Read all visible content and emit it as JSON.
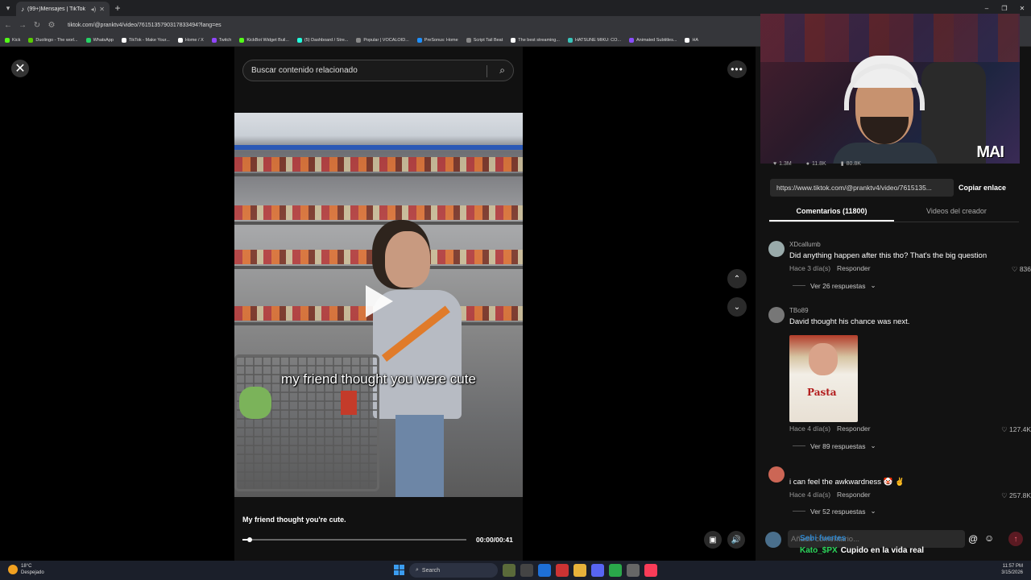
{
  "browser": {
    "tab_title": "(99+)Mensajes | TikTok",
    "url": "tiktok.com/@pranktv4/video/7615135790317833494?lang=es",
    "bookmarks": [
      {
        "label": "Kick",
        "color": "#53fc18"
      },
      {
        "label": "Duolingo - The worl...",
        "color": "#58cc02"
      },
      {
        "label": "WhatsApp",
        "color": "#25d366"
      },
      {
        "label": "TikTok - Make Your...",
        "color": "#ffffff"
      },
      {
        "label": "Home / X",
        "color": "#ffffff"
      },
      {
        "label": "Twitch",
        "color": "#9146ff"
      },
      {
        "label": "KickBot Widget Buil...",
        "color": "#53fc18"
      },
      {
        "label": "(5) Dashboard / Stre...",
        "color": "#2fd"
      },
      {
        "label": "Popular | VOCALOID...",
        "color": "#888888"
      },
      {
        "label": "PreSonus: Home",
        "color": "#1e90ff"
      },
      {
        "label": "Script Tail Beat",
        "color": "#888888"
      },
      {
        "label": "The best streaming...",
        "color": "#ffffff"
      },
      {
        "label": "HATSUNE MIKU: CO...",
        "color": "#39c5bb"
      },
      {
        "label": "Animated Subtitles...",
        "color": "#8a4dff"
      },
      {
        "label": "HA",
        "color": "#ffffff"
      }
    ]
  },
  "search": {
    "placeholder": "Buscar contenido relacionado"
  },
  "video": {
    "caption_overlay": "my friend thought you were cute",
    "description": "My friend thought you're cute.",
    "time": "00:00/00:41",
    "progress": 0.02
  },
  "panel": {
    "stats": [
      "1.3M",
      "11.8K",
      "80.8K"
    ],
    "share_url": "https://www.tiktok.com/@pranktv4/video/7615135...",
    "copy_label": "Copiar enlace",
    "tabs": [
      "Comentarios (11800)",
      "Videos del creador"
    ],
    "webcam_label": "MAI"
  },
  "comments": [
    {
      "user": "XDcallumb",
      "text": "Did anything happen after this tho? That's the big question",
      "time": "Hace 3 día(s)",
      "reply": "Responder",
      "likes": "836",
      "replies": "Ver 26 respuestas"
    },
    {
      "user": "TBo89",
      "text": "David thought his chance was next.",
      "time": "Hace 4 día(s)",
      "reply": "Responder",
      "likes": "127.4K",
      "replies": "Ver 89 respuestas",
      "gif_text": "Pasta"
    },
    {
      "user": "",
      "text": "i can feel the awkwardness 🤡 ✌",
      "time": "Hace 4 día(s)",
      "reply": "Responder",
      "likes": "257.8K",
      "replies": "Ver 52 respuestas"
    }
  ],
  "compose": {
    "placeholder": "Añadir comentario..."
  },
  "chat": {
    "name": "Kato_$PX",
    "message": "Cupido en la vida real",
    "overlay_top": "Sebi fuertes"
  },
  "taskbar": {
    "temp": "18°C",
    "weather": "Despejado",
    "search_label": "Search",
    "time": "11:57 PM",
    "date": "3/15/2026"
  }
}
